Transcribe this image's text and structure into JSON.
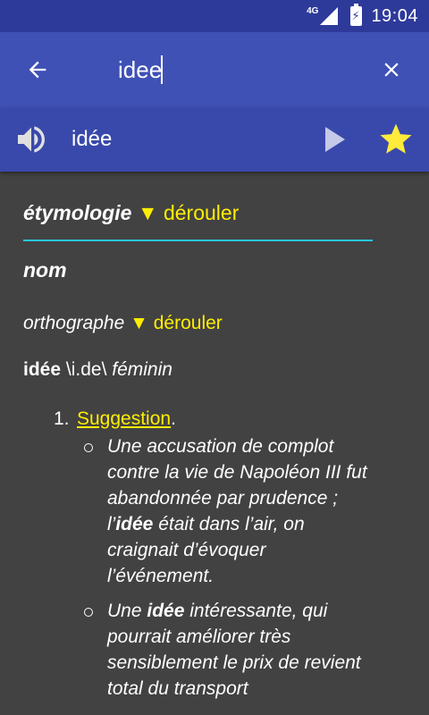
{
  "status_bar": {
    "network": "4G",
    "time": "19:04"
  },
  "search": {
    "query": "idee",
    "back_icon": "arrow-left-icon",
    "clear_icon": "close-icon"
  },
  "word_bar": {
    "word": "idée",
    "speaker_icon": "speaker-icon",
    "play_icon": "play-icon",
    "star_icon": "star-icon",
    "star_color": "#ffeb3b"
  },
  "content": {
    "etymology": {
      "title": "étymologie",
      "toggle": "▼ dérouler"
    },
    "part_of_speech": "nom",
    "orthography": {
      "label": "orthographe",
      "toggle": "▼ dérouler"
    },
    "headword": {
      "word": "idée",
      "pronunciation": "\\i.de\\",
      "gender": "féminin"
    },
    "definitions": [
      {
        "number": "1.",
        "link": "Suggestion",
        "punct": ".",
        "examples": [
          {
            "before": "Une accusation de complot contre la vie de Napoléon III fut abandonnée par prudence ; l’",
            "highlight": "idée",
            "after": " était dans l’air, on craignait d’évoquer l’événement."
          },
          {
            "before": "Une ",
            "highlight": "idée",
            "after": " intéressante, qui pourrait améliorer très sensiblement le prix de revient total du transport"
          }
        ]
      }
    ]
  },
  "colors": {
    "status_bar": "#2e3a9a",
    "app_bar": "#3f51b5",
    "word_bar": "#3949ab",
    "background": "#424242",
    "accent_yellow": "#ffee00",
    "divider_cyan": "#26c6da"
  }
}
